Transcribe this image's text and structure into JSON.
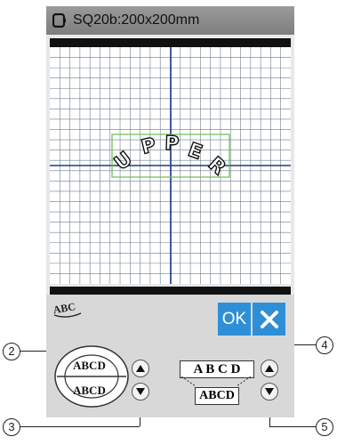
{
  "header": {
    "title": "SQ20b:200x200mm",
    "hoop_icon": "hoop-icon"
  },
  "design": {
    "text": "UPPER",
    "style": "arc-upper"
  },
  "toolbar": {
    "ok_label": "OK",
    "close_icon": "close-x-icon",
    "font_icon": "abc-font-icon"
  },
  "circle_layout": {
    "upper": "ABCD",
    "lower": "ABCD"
  },
  "straight_layout": {
    "upper": "A B C D",
    "lower": "ABCD"
  },
  "callouts": {
    "c2": "2",
    "c3": "3",
    "c4": "4",
    "c5": "5"
  },
  "colors": {
    "accent": "#2f8fd6",
    "grid_line": "#6c7f8e",
    "axis": "#1f3a8a",
    "frame": "#6abf4b"
  }
}
